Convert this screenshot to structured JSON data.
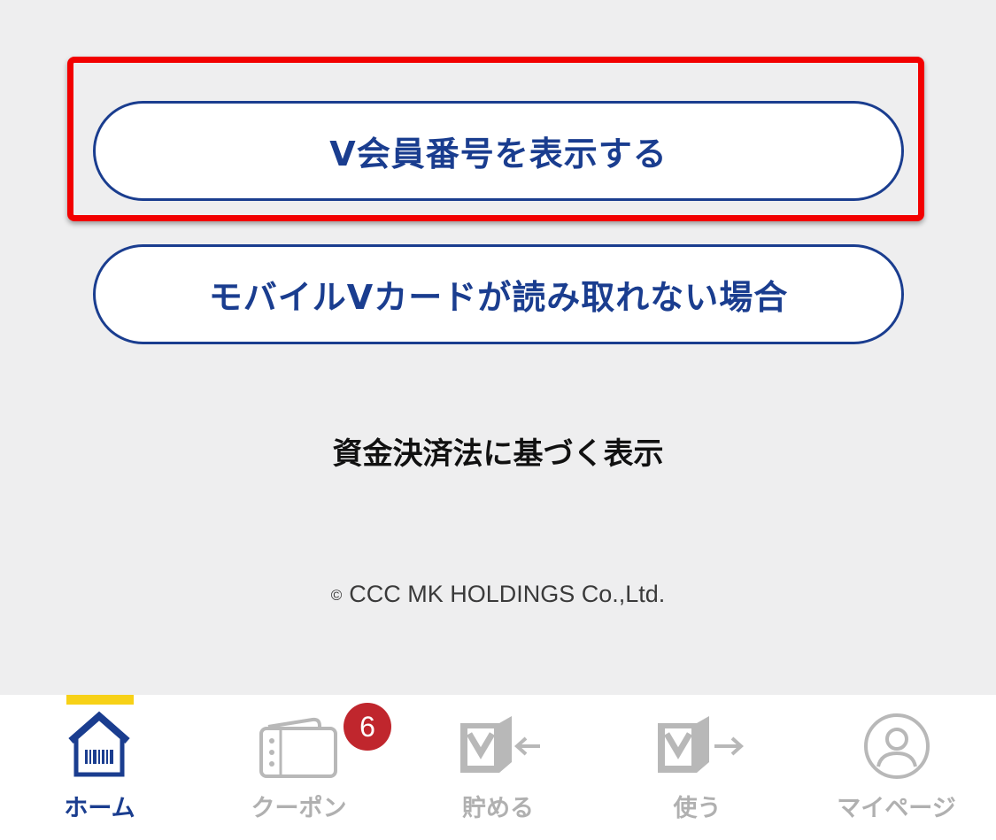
{
  "buttons": {
    "member_number": "V会員番号を表示する",
    "card_unreadable": "モバイルVカードが読み取れない場合"
  },
  "legal": {
    "payment_act_notice": "資金決済法に基づく表示"
  },
  "footer": {
    "copyright_symbol": "©",
    "copyright": "CCC MK HOLDINGS Co.,Ltd."
  },
  "tabbar": {
    "active_tab": "home",
    "coupon_badge": "6",
    "tabs": [
      {
        "id": "home",
        "label": "ホーム",
        "icon": "home-barcode-icon"
      },
      {
        "id": "coupon",
        "label": "クーポン",
        "icon": "coupon-book-icon"
      },
      {
        "id": "earn",
        "label": "貯める",
        "icon": "earn-points-icon"
      },
      {
        "id": "use",
        "label": "使う",
        "icon": "use-points-icon"
      },
      {
        "id": "mypage",
        "label": "マイページ",
        "icon": "user-profile-icon"
      }
    ]
  },
  "colors": {
    "brand_navy": "#1a3d8f",
    "highlight_red": "#f20000",
    "active_indicator": "#f7d117",
    "badge_red": "#c0262d",
    "inactive_gray": "#b0b0b0",
    "background": "#eeeeef"
  }
}
